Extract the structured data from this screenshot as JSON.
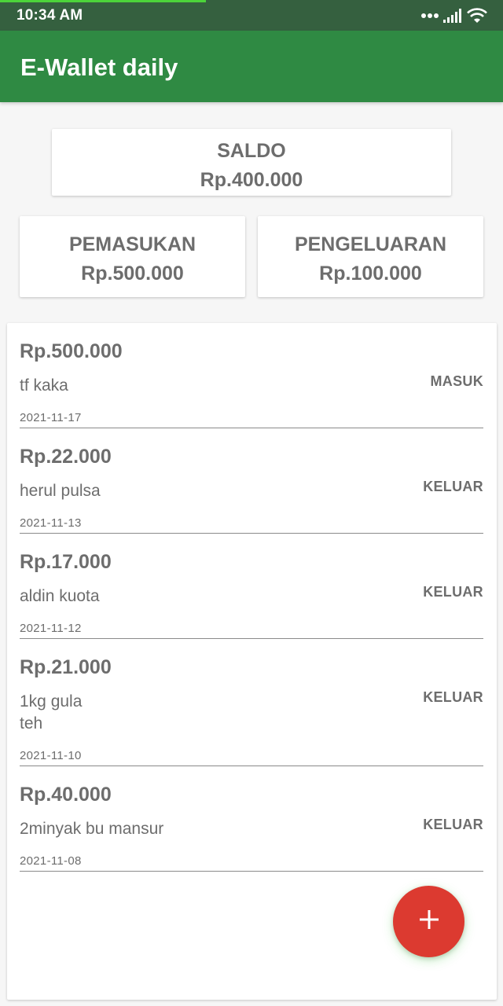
{
  "status_bar": {
    "time": "10:34 AM",
    "icons": [
      "more-dots-icon",
      "signal-icon",
      "wifi-icon"
    ]
  },
  "app_bar": {
    "title": "E-Wallet daily",
    "color": "#2f8a43"
  },
  "summary": {
    "saldo": {
      "label": "SALDO",
      "value": "Rp.400.000"
    },
    "pemasukan": {
      "label": "PEMASUKAN",
      "value": "Rp.500.000"
    },
    "pengeluaran": {
      "label": "PENGELUARAN",
      "value": "Rp.100.000"
    }
  },
  "transactions": [
    {
      "amount": "Rp.500.000",
      "note_lines": [
        "tf kaka"
      ],
      "type": "MASUK",
      "date": "2021-11-17"
    },
    {
      "amount": "Rp.22.000",
      "note_lines": [
        "herul pulsa"
      ],
      "type": "KELUAR",
      "date": "2021-11-13"
    },
    {
      "amount": "Rp.17.000",
      "note_lines": [
        "aldin kuota"
      ],
      "type": "KELUAR",
      "date": "2021-11-12"
    },
    {
      "amount": "Rp.21.000",
      "note_lines": [
        "1kg gula",
        "teh"
      ],
      "type": "KELUAR",
      "date": "2021-11-10"
    },
    {
      "amount": "Rp.40.000",
      "note_lines": [
        "2minyak bu mansur"
      ],
      "type": "KELUAR",
      "date": "2021-11-08"
    }
  ],
  "fab": {
    "icon": "plus-icon",
    "color": "#dc3a30"
  }
}
